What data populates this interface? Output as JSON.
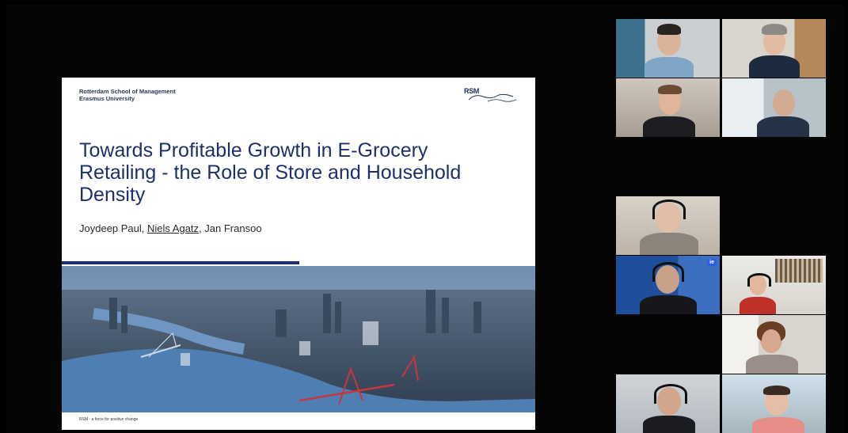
{
  "slide": {
    "org_line1": "Rotterdam School of Management",
    "org_line2": "Erasmus University",
    "logo_text": "RSM",
    "title": "Towards Profitable Growth in E-Grocery Retailing - the Role of Store and Household Density",
    "author1": "Joydeep Paul, ",
    "author2": "Niels Agatz",
    "author3": ", Jan Fransoo",
    "footer": "RSM - a force for positive change",
    "accent_color": "#1f2f6b"
  },
  "participants": [
    {
      "id": "p1"
    },
    {
      "id": "p2"
    },
    {
      "id": "p3"
    },
    {
      "id": "p4"
    },
    {
      "id": "p5"
    },
    {
      "id": "p6",
      "badge": "ie"
    },
    {
      "id": "p7"
    },
    {
      "id": "p8"
    },
    {
      "id": "p9"
    },
    {
      "id": "p10"
    }
  ]
}
